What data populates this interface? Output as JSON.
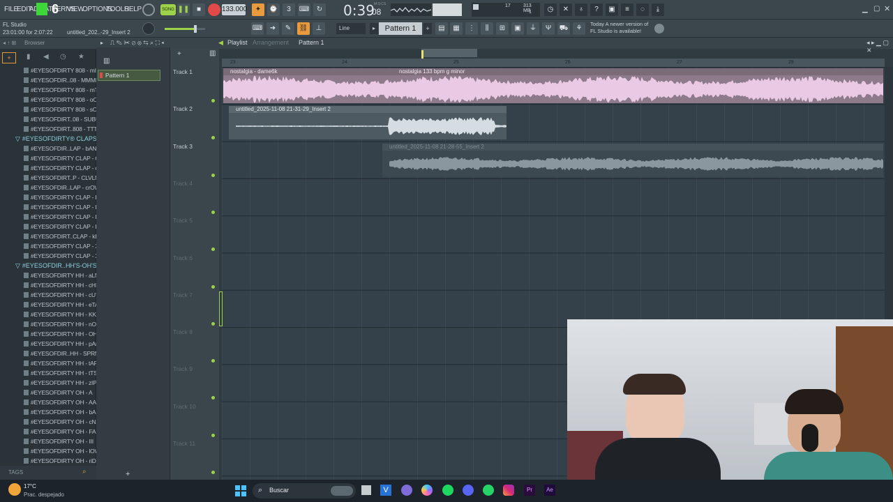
{
  "menu": [
    "FILE",
    "EDIT",
    "ADD",
    "PATTERNS",
    "VIEW",
    "OPTIONS",
    "TOOLS",
    "HELP"
  ],
  "overlay_digit": "6",
  "hint_line1": "FL Studio",
  "hint_line2": "23:01:00 for 2:07:22",
  "project_name": "untitled_202..-29_Insert 2",
  "tempo": "133.000",
  "song_mode": "SONG",
  "time_display": "0:39",
  "time_frac": "08",
  "time_label": "M:S:CS",
  "cpu_value": "17",
  "mem_value": "313 MB",
  "mem_sub": "1",
  "snap_mode": "Line",
  "pattern_selector": "Pattern 1",
  "news_line1": "Today  A newer version of",
  "news_line2": "FL Studio is available!",
  "browser_title": "Browser",
  "browser_items": [
    {
      "type": "file",
      "label": "#EYESOFDIRTY 808 - mINi"
    },
    {
      "type": "file",
      "label": "#EYESOFDIR..08 - MMMM"
    },
    {
      "type": "file",
      "label": "#EYESOFDIRTY 808 - mTR"
    },
    {
      "type": "file",
      "label": "#EYESOFDIRTY 808 - oOOO"
    },
    {
      "type": "file",
      "label": "#EYESOFDIRTY 808 - sOFT"
    },
    {
      "type": "file",
      "label": "#EYESOFDIRT..08 - SUBUc"
    },
    {
      "type": "file",
      "label": "#EYESOFDIRT..808 - TTTTT"
    },
    {
      "type": "folder",
      "label": "#EYESOFDIRTY® CLAPS"
    },
    {
      "type": "file",
      "label": "#EYESOFDIR..LAP - bANDS"
    },
    {
      "type": "file",
      "label": "#EYESOFDIRTY CLAP - CCC"
    },
    {
      "type": "file",
      "label": "#EYESOFDIRTY CLAP - cLN"
    },
    {
      "type": "file",
      "label": "#EYESOFDIRT..P - CLVLNd"
    },
    {
      "type": "file",
      "label": "#EYESOFDIR..LAP - crOWD"
    },
    {
      "type": "file",
      "label": "#EYESOFDIRTY CLAP - EVA"
    },
    {
      "type": "file",
      "label": "#EYESOFDIRTY CLAP - I"
    },
    {
      "type": "file",
      "label": "#EYESOFDIRTY CLAP - II"
    },
    {
      "type": "file",
      "label": "#EYESOFDIRTY CLAP - III"
    },
    {
      "type": "file",
      "label": "#EYESOFDIRT..CLAP - kKU!"
    },
    {
      "type": "file",
      "label": "#EYESOFDIRTY CLAP - Xr"
    },
    {
      "type": "file",
      "label": "#EYESOFDIRTY CLAP - XXX"
    },
    {
      "type": "folder",
      "label": "#EYESOFDIR..HH'S-OH'S"
    },
    {
      "type": "file",
      "label": "#EYESOFDIRTY HH - aLM"
    },
    {
      "type": "file",
      "label": "#EYESOFDIRTY HH - cHE"
    },
    {
      "type": "file",
      "label": "#EYESOFDIRTY HH - cUT"
    },
    {
      "type": "file",
      "label": "#EYESOFDIRTY HH - eTA"
    },
    {
      "type": "file",
      "label": "#EYESOFDIRTY HH - KK"
    },
    {
      "type": "file",
      "label": "#EYESOFDIRTY HH - nOS"
    },
    {
      "type": "file",
      "label": "#EYESOFDIRTY HH - OHm"
    },
    {
      "type": "file",
      "label": "#EYESOFDIRTY HH - pArt"
    },
    {
      "type": "file",
      "label": "#EYESOFDIR..HH - SPRNo"
    },
    {
      "type": "file",
      "label": "#EYESOFDIRTY HH - tAP"
    },
    {
      "type": "file",
      "label": "#EYESOFDIRTY HH - tTS"
    },
    {
      "type": "file",
      "label": "#EYESOFDIRTY HH - zIP"
    },
    {
      "type": "file",
      "label": "#EYESOFDIRTY OH - A"
    },
    {
      "type": "file",
      "label": "#EYESOFDIRTY OH - AAA"
    },
    {
      "type": "file",
      "label": "#EYESOFDIRTY OH - bAR"
    },
    {
      "type": "file",
      "label": "#EYESOFDIRTY OH - cNZX"
    },
    {
      "type": "file",
      "label": "#EYESOFDIRTY OH - FAH"
    },
    {
      "type": "file",
      "label": "#EYESOFDIRTY OH - III"
    },
    {
      "type": "file",
      "label": "#EYESOFDIRTY OH - lOW"
    },
    {
      "type": "file",
      "label": "#EYESOFDIRTY OH - riDE"
    }
  ],
  "tags_label": "TAGS",
  "picker_pattern": "Pattern 1",
  "playlist_title": "Playlist",
  "playlist_sub": "Arrangement",
  "playlist_pattern": "Pattern 1",
  "ruler_marks": [
    "23",
    "24",
    "25",
    "26",
    "27",
    "28"
  ],
  "tracks": [
    "Track 1",
    "Track 2",
    "Track 3",
    "Track 4",
    "Track 5",
    "Track 6",
    "Track 7",
    "Track 8",
    "Track 9",
    "Track 10",
    "Track 11"
  ],
  "clips": {
    "c1a": "nostalgia - dame6k",
    "c1b": "nostalgia 133 bpm g minor",
    "c2": "untitled_2025-11-08 21-31-29_Insert 2",
    "c3": "untitled_2025-11-08 21-28-55_Insert 2"
  },
  "weather_temp": "17°C",
  "weather_desc": "Prac. despejado",
  "search_label": "Buscar",
  "colors": {
    "accent": "#e89a3c",
    "clip_pink": "#d9b7d4",
    "grid": "#34414a",
    "green": "#9ed24a"
  }
}
